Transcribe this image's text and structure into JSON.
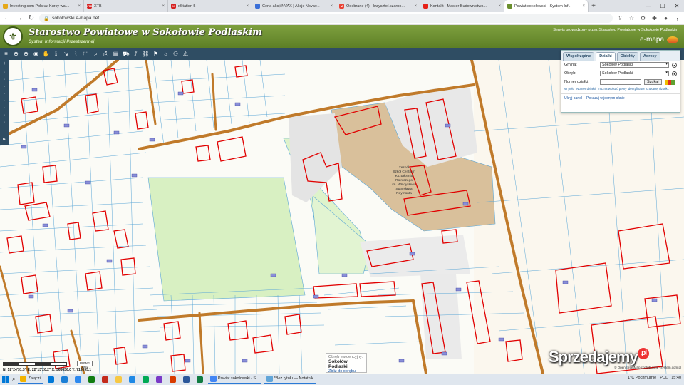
{
  "browser": {
    "tabs": [
      {
        "title": "Investing.com Polska: Kursy wal...",
        "fav_color": "#e6a817",
        "fav_text": ""
      },
      {
        "title": "XTB",
        "fav_color": "#d62020",
        "fav_text": "XTB"
      },
      {
        "title": "xStation 5",
        "fav_color": "#d62020",
        "fav_text": "X"
      },
      {
        "title": "Cena akcji NVAX | Akcje Novav...",
        "fav_color": "#3a6fd8",
        "fav_text": ""
      },
      {
        "title": "Odebrane (4) - krzysztof.czarno...",
        "fav_color": "#ea4335",
        "fav_text": "M"
      },
      {
        "title": "Kontakt - Master Budownictwo...",
        "fav_color": "#e62117",
        "fav_text": ""
      },
      {
        "title": "Powiat sokołowski - System Inf...",
        "fav_color": "#6a8f2e",
        "fav_text": "",
        "active": true
      }
    ],
    "new_tab": "+",
    "url": "sokolowski.e-mapa.net"
  },
  "header": {
    "title": "Starostwo Powiatowe w Sokołowie Podlaskim",
    "subtitle": "System Informacji Przestrzennej",
    "right_note": "Serwis prowadzony przez Starostwo Powiatowe w Sokołowie Podlaskim",
    "brand": "e-mapa"
  },
  "search_panel": {
    "tabs": [
      "Współrzędne",
      "Działki",
      "Obiekty",
      "Adresy"
    ],
    "active_tab": "Działki",
    "gmina_label": "Gmina:",
    "gmina_value": "Sokołów Podlaski",
    "obreb_label": "Obręb:",
    "obreb_value": "Sokołów Podlaski",
    "numer_label": "Numer działki:",
    "numer_value": "",
    "search_button": "Szukaj",
    "note": "W polu \"Numer działki\" można wpisać pełny identyfikator szukanej działki.",
    "link_hide": "Ukryj panel",
    "link_show": "Pokazuj w jednym oknie"
  },
  "map": {
    "labels": {
      "school": [
        "Zespół",
        "Szkół Centrum",
        "Kształcenia",
        "Rolniczego",
        "im. Władysława",
        "Stanisława",
        "Reymonta"
      ],
      "obreb_title": "Obręb ewidencyjny:",
      "obreb_value": "Sokołów Podlaski",
      "obreb_link": "Zbliż do obrębu"
    },
    "zoom_select": "PUWG 1992",
    "coords": "N: 52°24'31.3\"  E: 22°13'20.2\"  X: 568636.0  Y: 719095.1",
    "attribution": "© OpenStreetMap contributors · system.com.pl"
  },
  "watermark": {
    "text": "Sprzedajemy",
    "dot": ".pl"
  },
  "taskbar": {
    "items": [
      {
        "label": "Załączi",
        "color": "#f2b300",
        "open": true
      },
      {
        "label": "",
        "color": "#0078d7",
        "open": false
      },
      {
        "label": "",
        "color": "#1b7fd6",
        "open": false
      },
      {
        "label": "",
        "color": "#2d89ef",
        "open": false
      },
      {
        "label": "",
        "color": "#107c10",
        "open": false
      },
      {
        "label": "",
        "color": "#c42b1c",
        "open": false
      },
      {
        "label": "",
        "color": "#f7c844",
        "open": false
      },
      {
        "label": "",
        "color": "#1e88e5",
        "open": false
      },
      {
        "label": "",
        "color": "#0a5",
        "open": false
      },
      {
        "label": "",
        "color": "#7a3ac7",
        "open": false
      },
      {
        "label": "",
        "color": "#d83b01",
        "open": false
      },
      {
        "label": "",
        "color": "#2b579a",
        "open": false
      },
      {
        "label": "",
        "color": "#107c41",
        "open": false
      },
      {
        "label": "Powiat sokołowski - S...",
        "color": "#4285f4",
        "open": true
      },
      {
        "label": "*Bez tytułu — Notatnik",
        "color": "#61a5d8",
        "open": true
      }
    ],
    "tray": {
      "weather": "1°C  Pochmurnie",
      "keyboard": "POL",
      "time": "15:40"
    }
  },
  "colors": {
    "header_green": "#6a8f2e",
    "toolbar": "#2f4d63",
    "building": "#e10000",
    "road": "#c07a2a",
    "parcel": "#5aa6d6"
  }
}
